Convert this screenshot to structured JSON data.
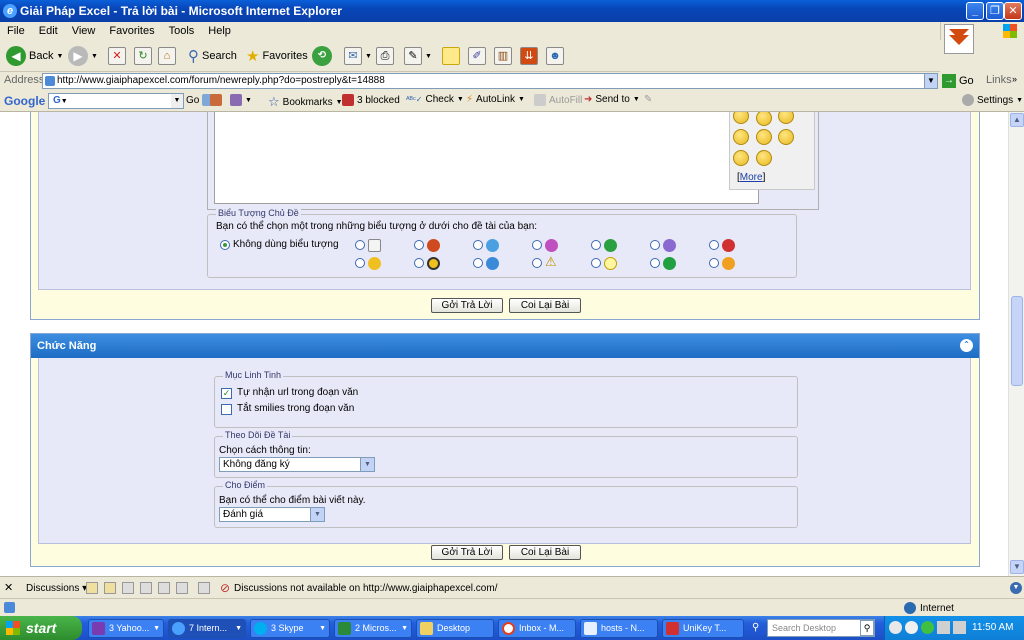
{
  "window": {
    "title": "Giải Pháp Excel - Trả lời bài - Microsoft Internet Explorer"
  },
  "menu": [
    "File",
    "Edit",
    "View",
    "Favorites",
    "Tools",
    "Help"
  ],
  "toolbar": {
    "back": "Back",
    "search": "Search",
    "favorites": "Favorites"
  },
  "address": {
    "label": "Address",
    "url": "http://www.giaiphapexcel.com/forum/newreply.php?do=postreply&t=14888",
    "go": "Go",
    "links": "Links"
  },
  "googlebar": {
    "logo": "Google",
    "go": "Go",
    "bookmarks": "Bookmarks",
    "blocked": "3 blocked",
    "check": "Check",
    "autolink": "AutoLink",
    "autofill": "AutoFill",
    "sendto": "Send to",
    "settings": "Settings"
  },
  "smilies": {
    "more": "More"
  },
  "post_icons": {
    "legend": "Biểu Tượng Chủ Đề",
    "description": "Bạn có thể chọn một trong những biểu tượng ở dưới cho đề tài của bạn:",
    "none_label": "Không dùng biểu tượng"
  },
  "buttons": {
    "submit": "Gởi Trả Lời",
    "preview": "Coi Lại Bài"
  },
  "functions": {
    "title": "Chức Năng",
    "misc": {
      "legend": "Mục Linh Tinh",
      "parse_url": "Tự nhận url trong đoạn văn",
      "disable_smilies": "Tắt smilies trong đoạn văn"
    },
    "subscribe": {
      "legend": "Theo Dõi Đề Tài",
      "prompt": "Chọn cách thông tin:",
      "value": "Không đăng ký"
    },
    "rating": {
      "legend": "Cho Điểm",
      "prompt": "Bạn có thể cho điểm bài viết này.",
      "value": "Đánh giá"
    }
  },
  "discussions": {
    "label": "Discussions",
    "message": "Discussions not available on http://www.giaiphapexcel.com/"
  },
  "status": {
    "zone": "Internet"
  },
  "taskbar": {
    "start": "start",
    "tasks": [
      "3 Yahoo...",
      "7 Intern...",
      "3 Skype",
      "2 Micros...",
      "Desktop",
      "Inbox - M...",
      "hosts - N...",
      "UniKey T..."
    ],
    "search_placeholder": "Search Desktop",
    "clock": "11:50 AM"
  }
}
